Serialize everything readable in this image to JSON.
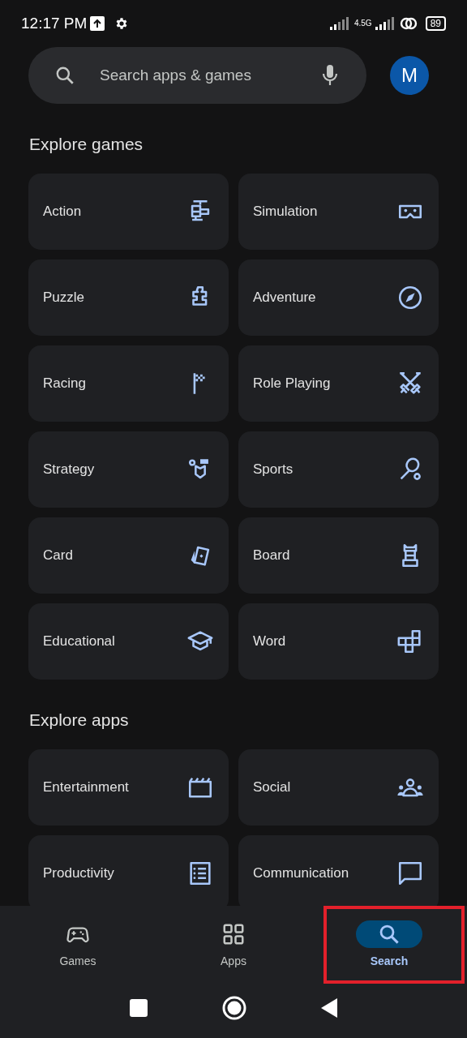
{
  "status_bar": {
    "time": "12:17 PM",
    "network": "4.5G",
    "battery": "89"
  },
  "search": {
    "placeholder": "Search apps & games",
    "avatar": "M"
  },
  "sections": [
    {
      "title": "Explore games",
      "tiles": [
        {
          "label": "Action"
        },
        {
          "label": "Simulation"
        },
        {
          "label": "Puzzle"
        },
        {
          "label": "Adventure"
        },
        {
          "label": "Racing"
        },
        {
          "label": "Role Playing"
        },
        {
          "label": "Strategy"
        },
        {
          "label": "Sports"
        },
        {
          "label": "Card"
        },
        {
          "label": "Board"
        },
        {
          "label": "Educational"
        },
        {
          "label": "Word"
        }
      ]
    },
    {
      "title": "Explore apps",
      "tiles": [
        {
          "label": "Entertainment"
        },
        {
          "label": "Social"
        },
        {
          "label": "Productivity"
        },
        {
          "label": "Communication"
        }
      ]
    }
  ],
  "bottom_nav": [
    {
      "label": "Games",
      "selected": false,
      "highlighted": false
    },
    {
      "label": "Apps",
      "selected": false,
      "highlighted": false
    },
    {
      "label": "Search",
      "selected": true,
      "highlighted": true
    }
  ]
}
